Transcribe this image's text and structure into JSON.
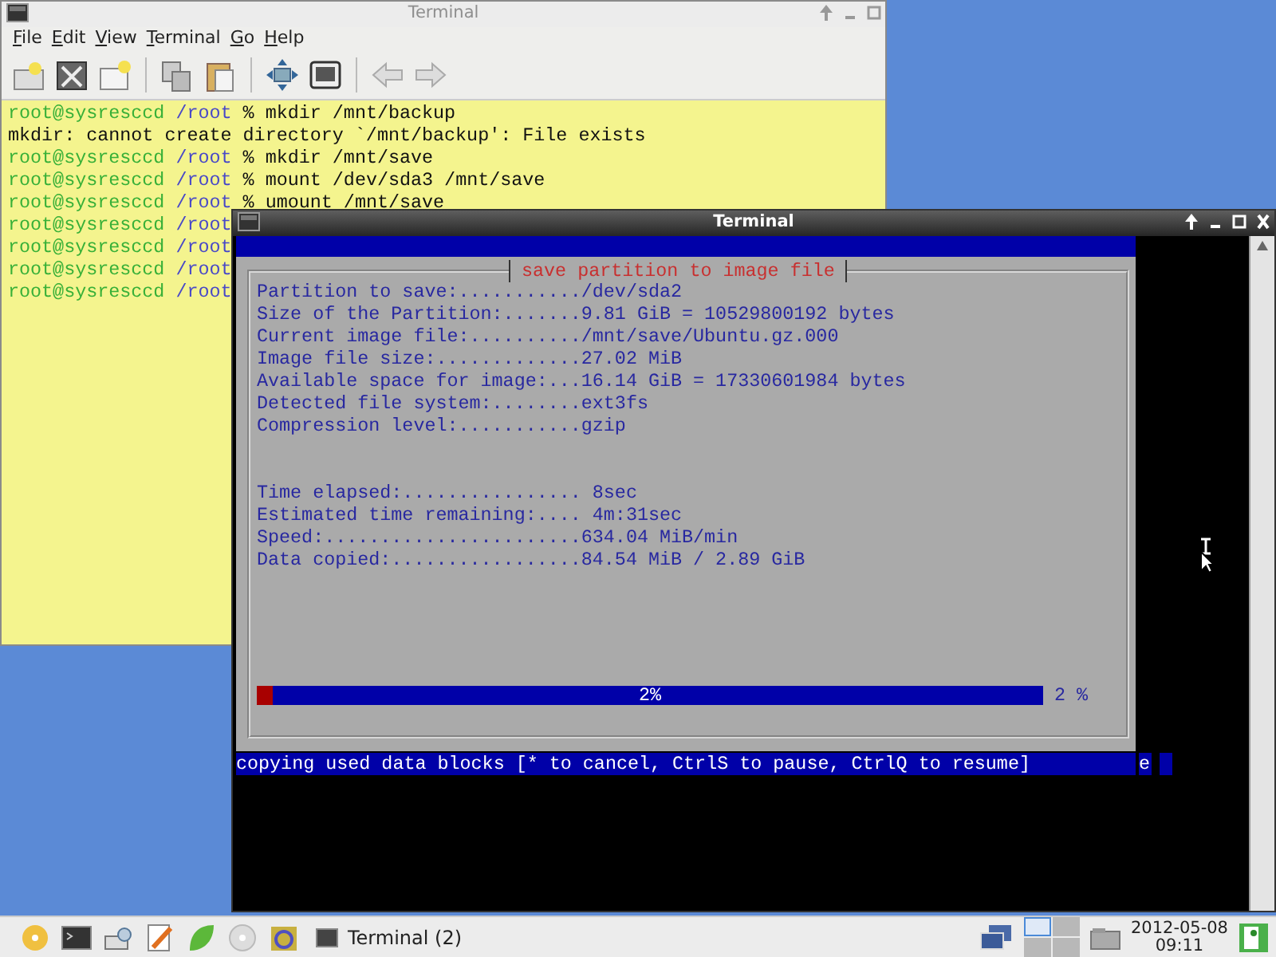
{
  "windows": [
    {
      "title": "Terminal",
      "active": false,
      "menu": [
        "File",
        "Edit",
        "View",
        "Terminal",
        "Go",
        "Help"
      ],
      "lines": [
        {
          "kind": "prompt",
          "host": "root@sysresccd",
          "dir": "/root",
          "command": "% mkdir /mnt/backup"
        },
        {
          "kind": "output",
          "text": "mkdir: cannot create directory `/mnt/backup': File exists"
        },
        {
          "kind": "prompt",
          "host": "root@sysresccd",
          "dir": "/root",
          "command": "% mkdir /mnt/save"
        },
        {
          "kind": "prompt",
          "host": "root@sysresccd",
          "dir": "/root",
          "command": "% mount /dev/sda3 /mnt/save"
        },
        {
          "kind": "prompt",
          "host": "root@sysresccd",
          "dir": "/root",
          "command": "% umount /mnt/save"
        },
        {
          "kind": "prompt",
          "host": "root@sysresccd",
          "dir": "/root"
        },
        {
          "kind": "prompt",
          "host": "root@sysresccd",
          "dir": "/root"
        },
        {
          "kind": "prompt",
          "host": "root@sysresccd",
          "dir": "/root"
        },
        {
          "kind": "prompt",
          "host": "root@sysresccd",
          "dir": "/root"
        }
      ]
    },
    {
      "title": "Terminal",
      "active": true,
      "dialog": {
        "title": "save partition to image file",
        "info_lines": [
          "Partition to save:.........../dev/sda2",
          "Size of the Partition:.......9.81 GiB = 10529800192 bytes",
          "Current image file:........../mnt/save/Ubuntu.gz.000",
          "Image file size:.............27.02 MiB",
          "Available space for image:...16.14 GiB = 17330601984 bytes",
          "Detected file system:........ext3fs",
          "Compression level:...........gzip"
        ],
        "progress_lines": [
          "Time elapsed:................ 8sec",
          "Estimated time remaining:.... 4m:31sec",
          "Speed:.......................634.04 MiB/min",
          "Data copied:.................84.54 MiB / 2.89 GiB"
        ],
        "progress": {
          "level": 0.02,
          "label": "2%",
          "reading": "2 %"
        }
      },
      "status_line": "copying used data blocks [* to cancel, CtrlS to pause, CtrlQ to resume]",
      "status_tail": "e"
    }
  ],
  "taskbar": {
    "task": "Terminal (2)",
    "workspaces": [
      {
        "selected": true
      },
      {
        "selected": false
      },
      {
        "selected": false
      },
      {
        "selected": false
      }
    ],
    "date": "2012-05-08",
    "time": "09:11"
  }
}
